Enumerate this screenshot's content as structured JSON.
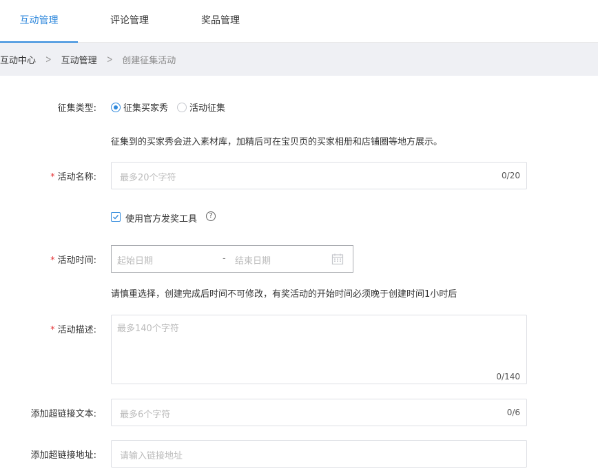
{
  "tabs": [
    {
      "label": "互动管理",
      "active": true
    },
    {
      "label": "评论管理",
      "active": false
    },
    {
      "label": "奖品管理",
      "active": false
    }
  ],
  "breadcrumb": [
    "互动中心",
    "互动管理",
    "创建征集活动"
  ],
  "form": {
    "type_label": "征集类型:",
    "type_options": [
      "征集买家秀",
      "活动征集"
    ],
    "type_selected": "征集买家秀",
    "type_help": "征集到的买家秀会进入素材库，加精后可在宝贝页的买家相册和店铺圈等地方展示。",
    "required_mark": "*",
    "name_label": "活动名称:",
    "name_placeholder": "最多20个字符",
    "name_count": "0/20",
    "official_tool_label": "使用官方发奖工具",
    "official_tool_checked": true,
    "help_icon_glyph": "?",
    "time_label": "活动时间:",
    "start_placeholder": "起始日期",
    "range_sep": "-",
    "end_placeholder": "结束日期",
    "time_help": "请慎重选择，创建完成后时间不可修改，有奖活动的开始时间必须晚于创建时间1小时后",
    "desc_label": "活动描述:",
    "desc_placeholder": "最多140个字符",
    "desc_count": "0/140",
    "link_text_label": "添加超链接文本:",
    "link_text_placeholder": "最多6个字符",
    "link_text_count": "0/6",
    "link_url_label": "添加超链接地址:",
    "link_url_placeholder": "请输入链接地址"
  },
  "colors": {
    "accent": "#3089dc",
    "required": "#e5383b",
    "breadcrumb_bg": "#eff0f4"
  },
  "icons": [
    "chevron-right-icon",
    "check-icon",
    "question-icon",
    "calendar-icon"
  ]
}
